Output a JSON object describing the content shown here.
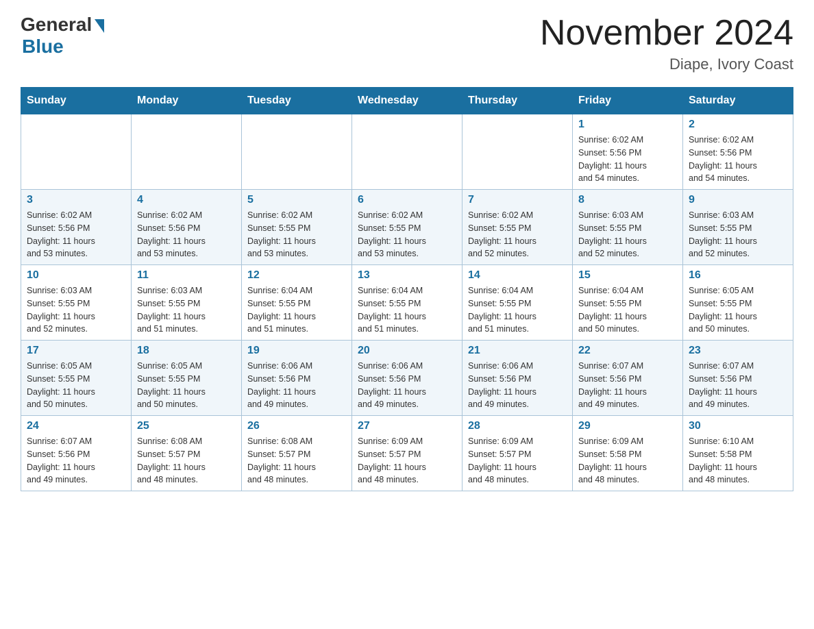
{
  "logo": {
    "general": "General",
    "blue": "Blue"
  },
  "title": "November 2024",
  "location": "Diape, Ivory Coast",
  "days_of_week": [
    "Sunday",
    "Monday",
    "Tuesday",
    "Wednesday",
    "Thursday",
    "Friday",
    "Saturday"
  ],
  "weeks": [
    {
      "days": [
        {
          "number": "",
          "info": ""
        },
        {
          "number": "",
          "info": ""
        },
        {
          "number": "",
          "info": ""
        },
        {
          "number": "",
          "info": ""
        },
        {
          "number": "",
          "info": ""
        },
        {
          "number": "1",
          "info": "Sunrise: 6:02 AM\nSunset: 5:56 PM\nDaylight: 11 hours\nand 54 minutes."
        },
        {
          "number": "2",
          "info": "Sunrise: 6:02 AM\nSunset: 5:56 PM\nDaylight: 11 hours\nand 54 minutes."
        }
      ]
    },
    {
      "days": [
        {
          "number": "3",
          "info": "Sunrise: 6:02 AM\nSunset: 5:56 PM\nDaylight: 11 hours\nand 53 minutes."
        },
        {
          "number": "4",
          "info": "Sunrise: 6:02 AM\nSunset: 5:56 PM\nDaylight: 11 hours\nand 53 minutes."
        },
        {
          "number": "5",
          "info": "Sunrise: 6:02 AM\nSunset: 5:55 PM\nDaylight: 11 hours\nand 53 minutes."
        },
        {
          "number": "6",
          "info": "Sunrise: 6:02 AM\nSunset: 5:55 PM\nDaylight: 11 hours\nand 53 minutes."
        },
        {
          "number": "7",
          "info": "Sunrise: 6:02 AM\nSunset: 5:55 PM\nDaylight: 11 hours\nand 52 minutes."
        },
        {
          "number": "8",
          "info": "Sunrise: 6:03 AM\nSunset: 5:55 PM\nDaylight: 11 hours\nand 52 minutes."
        },
        {
          "number": "9",
          "info": "Sunrise: 6:03 AM\nSunset: 5:55 PM\nDaylight: 11 hours\nand 52 minutes."
        }
      ]
    },
    {
      "days": [
        {
          "number": "10",
          "info": "Sunrise: 6:03 AM\nSunset: 5:55 PM\nDaylight: 11 hours\nand 52 minutes."
        },
        {
          "number": "11",
          "info": "Sunrise: 6:03 AM\nSunset: 5:55 PM\nDaylight: 11 hours\nand 51 minutes."
        },
        {
          "number": "12",
          "info": "Sunrise: 6:04 AM\nSunset: 5:55 PM\nDaylight: 11 hours\nand 51 minutes."
        },
        {
          "number": "13",
          "info": "Sunrise: 6:04 AM\nSunset: 5:55 PM\nDaylight: 11 hours\nand 51 minutes."
        },
        {
          "number": "14",
          "info": "Sunrise: 6:04 AM\nSunset: 5:55 PM\nDaylight: 11 hours\nand 51 minutes."
        },
        {
          "number": "15",
          "info": "Sunrise: 6:04 AM\nSunset: 5:55 PM\nDaylight: 11 hours\nand 50 minutes."
        },
        {
          "number": "16",
          "info": "Sunrise: 6:05 AM\nSunset: 5:55 PM\nDaylight: 11 hours\nand 50 minutes."
        }
      ]
    },
    {
      "days": [
        {
          "number": "17",
          "info": "Sunrise: 6:05 AM\nSunset: 5:55 PM\nDaylight: 11 hours\nand 50 minutes."
        },
        {
          "number": "18",
          "info": "Sunrise: 6:05 AM\nSunset: 5:55 PM\nDaylight: 11 hours\nand 50 minutes."
        },
        {
          "number": "19",
          "info": "Sunrise: 6:06 AM\nSunset: 5:56 PM\nDaylight: 11 hours\nand 49 minutes."
        },
        {
          "number": "20",
          "info": "Sunrise: 6:06 AM\nSunset: 5:56 PM\nDaylight: 11 hours\nand 49 minutes."
        },
        {
          "number": "21",
          "info": "Sunrise: 6:06 AM\nSunset: 5:56 PM\nDaylight: 11 hours\nand 49 minutes."
        },
        {
          "number": "22",
          "info": "Sunrise: 6:07 AM\nSunset: 5:56 PM\nDaylight: 11 hours\nand 49 minutes."
        },
        {
          "number": "23",
          "info": "Sunrise: 6:07 AM\nSunset: 5:56 PM\nDaylight: 11 hours\nand 49 minutes."
        }
      ]
    },
    {
      "days": [
        {
          "number": "24",
          "info": "Sunrise: 6:07 AM\nSunset: 5:56 PM\nDaylight: 11 hours\nand 49 minutes."
        },
        {
          "number": "25",
          "info": "Sunrise: 6:08 AM\nSunset: 5:57 PM\nDaylight: 11 hours\nand 48 minutes."
        },
        {
          "number": "26",
          "info": "Sunrise: 6:08 AM\nSunset: 5:57 PM\nDaylight: 11 hours\nand 48 minutes."
        },
        {
          "number": "27",
          "info": "Sunrise: 6:09 AM\nSunset: 5:57 PM\nDaylight: 11 hours\nand 48 minutes."
        },
        {
          "number": "28",
          "info": "Sunrise: 6:09 AM\nSunset: 5:57 PM\nDaylight: 11 hours\nand 48 minutes."
        },
        {
          "number": "29",
          "info": "Sunrise: 6:09 AM\nSunset: 5:58 PM\nDaylight: 11 hours\nand 48 minutes."
        },
        {
          "number": "30",
          "info": "Sunrise: 6:10 AM\nSunset: 5:58 PM\nDaylight: 11 hours\nand 48 minutes."
        }
      ]
    }
  ]
}
